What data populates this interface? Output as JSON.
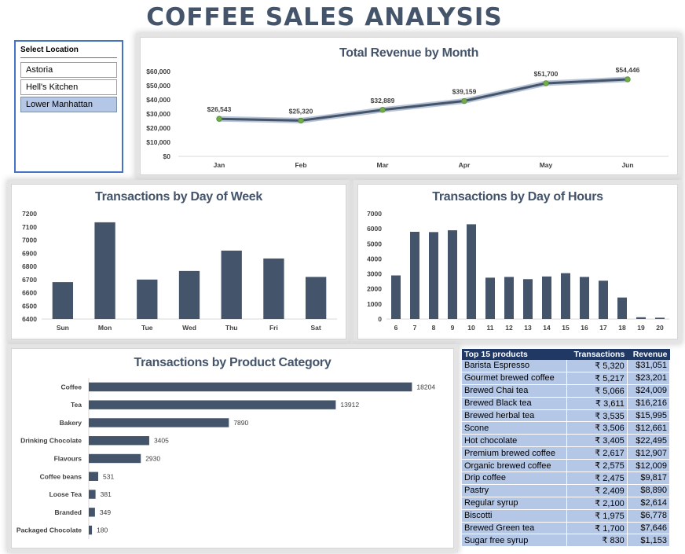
{
  "page_title": "COFFEE SALES ANALYSIS",
  "slicer": {
    "header": "Select Location",
    "items": [
      {
        "label": "Astoria",
        "selected": false
      },
      {
        "label": "Hell's Kitchen",
        "selected": false
      },
      {
        "label": "Lower Manhattan",
        "selected": true
      }
    ]
  },
  "colors": {
    "bar": "#44546a",
    "line": "#44546a",
    "marker": "#70ad47",
    "selected": "#b4c7e7",
    "header_bg": "#203864",
    "row_bg": "#b4c7e7"
  },
  "chart_data": [
    {
      "id": "revenue",
      "type": "line",
      "title": "Total Revenue by Month",
      "categories": [
        "Jan",
        "Feb",
        "Mar",
        "Apr",
        "May",
        "Jun"
      ],
      "values": [
        26543,
        25320,
        32889,
        39159,
        51700,
        54446
      ],
      "data_labels": [
        "$26,543",
        "$25,320",
        "$32,889",
        "$39,159",
        "$51,700",
        "$54,446"
      ],
      "y_ticks": [
        "$0",
        "$10,000",
        "$20,000",
        "$30,000",
        "$40,000",
        "$50,000",
        "$60,000"
      ],
      "ylim": [
        0,
        60000
      ]
    },
    {
      "id": "day_of_week",
      "type": "bar",
      "title": "Transactions by Day of Week",
      "categories": [
        "Sun",
        "Mon",
        "Tue",
        "Wed",
        "Thu",
        "Fri",
        "Sat"
      ],
      "values": [
        6680,
        7135,
        6700,
        6765,
        6920,
        6860,
        6720
      ],
      "y_ticks": [
        "6400",
        "6500",
        "6600",
        "6700",
        "6800",
        "6900",
        "7000",
        "7100",
        "7200"
      ],
      "ylim": [
        6400,
        7200
      ]
    },
    {
      "id": "hours",
      "type": "bar",
      "title": "Transactions by Day of Hours",
      "categories": [
        "6",
        "7",
        "8",
        "9",
        "10",
        "11",
        "12",
        "13",
        "14",
        "15",
        "16",
        "17",
        "18",
        "19",
        "20"
      ],
      "values": [
        2900,
        5800,
        5780,
        5900,
        6300,
        2750,
        2800,
        2650,
        2830,
        3050,
        2800,
        2550,
        1430,
        120,
        90
      ],
      "y_ticks": [
        "0",
        "1000",
        "2000",
        "3000",
        "4000",
        "5000",
        "6000",
        "7000"
      ],
      "ylim": [
        0,
        7000
      ]
    },
    {
      "id": "category",
      "type": "bar",
      "title": "Transactions by Product Category",
      "categories": [
        "Coffee",
        "Tea",
        "Bakery",
        "Drinking Chocolate",
        "Flavours",
        "Coffee beans",
        "Loose Tea",
        "Branded",
        "Packaged Chocolate"
      ],
      "values": [
        18204,
        13912,
        7890,
        3405,
        2930,
        531,
        381,
        349,
        180
      ],
      "data_labels": [
        "18204",
        "13912",
        "7890",
        "3405",
        "2930",
        "531",
        "381",
        "349",
        "180"
      ],
      "xlim": [
        0,
        20000
      ]
    }
  ],
  "top_products": {
    "headers": [
      "Top 15 products",
      "Transactions",
      "Revenue"
    ],
    "rows": [
      [
        "Barista Espresso",
        "₹ 5,320",
        "$31,051"
      ],
      [
        "Gourmet brewed coffee",
        "₹ 5,217",
        "$23,201"
      ],
      [
        "Brewed Chai tea",
        "₹ 5,066",
        "$24,009"
      ],
      [
        "Brewed Black tea",
        "₹ 3,611",
        "$16,216"
      ],
      [
        "Brewed herbal tea",
        "₹ 3,535",
        "$15,995"
      ],
      [
        "Scone",
        "₹ 3,506",
        "$12,661"
      ],
      [
        "Hot chocolate",
        "₹ 3,405",
        "$22,495"
      ],
      [
        "Premium brewed coffee",
        "₹ 2,617",
        "$12,907"
      ],
      [
        "Organic brewed coffee",
        "₹ 2,575",
        "$12,009"
      ],
      [
        "Drip coffee",
        "₹ 2,475",
        "$9,817"
      ],
      [
        "Pastry",
        "₹ 2,409",
        "$8,890"
      ],
      [
        "Regular syrup",
        "₹ 2,100",
        "$2,614"
      ],
      [
        "Biscotti",
        "₹ 1,975",
        "$6,778"
      ],
      [
        "Brewed Green tea",
        "₹ 1,700",
        "$7,646"
      ],
      [
        "Sugar free syrup",
        "₹ 830",
        "$1,153"
      ]
    ]
  }
}
